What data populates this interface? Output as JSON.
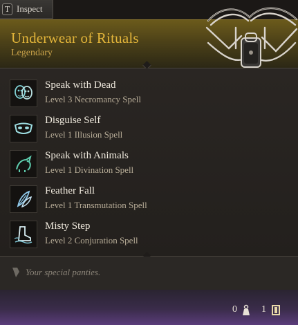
{
  "inspect": {
    "key": "T",
    "label": "Inspect"
  },
  "item": {
    "name": "Underwear of Rituals",
    "rarity": "Legendary",
    "art_icon": "underwear-icon",
    "name_color": "#e3b53a"
  },
  "spells": [
    {
      "name": "Speak with Dead",
      "detail": "Level 3 Necromancy Spell",
      "icon": "masks-icon"
    },
    {
      "name": "Disguise Self",
      "detail": "Level 1 Illusion Spell",
      "icon": "mask-icon"
    },
    {
      "name": "Speak with Animals",
      "detail": "Level 1 Divination Spell",
      "icon": "animal-icon"
    },
    {
      "name": "Feather Fall",
      "detail": "Level 1 Transmutation Spell",
      "icon": "feather-icon"
    },
    {
      "name": "Misty Step",
      "detail": "Level 2 Conjuration Spell",
      "icon": "boot-icon"
    }
  ],
  "description": "Your special panties.",
  "footer": {
    "weight_value": "0",
    "weight_icon": "weight-icon",
    "price_value": "1",
    "price_icon": "coin-icon"
  }
}
